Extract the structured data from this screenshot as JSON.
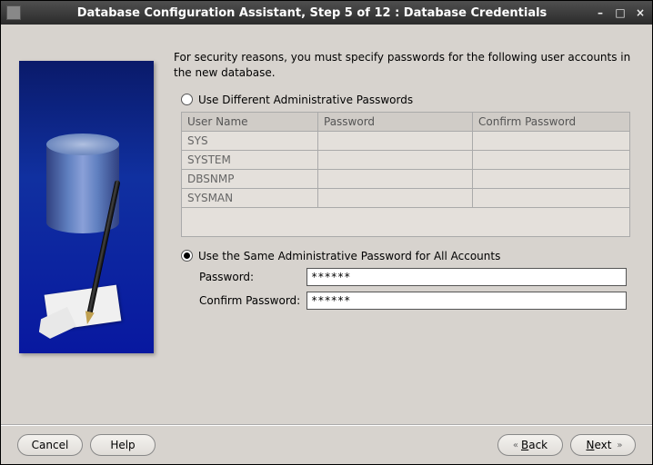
{
  "window": {
    "title": "Database Configuration Assistant, Step 5 of 12 : Database Credentials"
  },
  "intro": "For security reasons, you must specify passwords for the following user accounts in the new database.",
  "options": {
    "different": "Use Different Administrative Passwords",
    "same": "Use the Same Administrative Password for All Accounts",
    "selected": "same"
  },
  "table": {
    "headers": [
      "User Name",
      "Password",
      "Confirm Password"
    ],
    "rows": [
      {
        "user": "SYS",
        "password": "",
        "confirm": ""
      },
      {
        "user": "SYSTEM",
        "password": "",
        "confirm": ""
      },
      {
        "user": "DBSNMP",
        "password": "",
        "confirm": ""
      },
      {
        "user": "SYSMAN",
        "password": "",
        "confirm": ""
      }
    ]
  },
  "fields": {
    "password_label": "Password:",
    "password_value": "******",
    "confirm_label": "Confirm Password:",
    "confirm_value": "******"
  },
  "buttons": {
    "cancel": "Cancel",
    "help": "Help",
    "back": "Back",
    "next": "Next"
  }
}
